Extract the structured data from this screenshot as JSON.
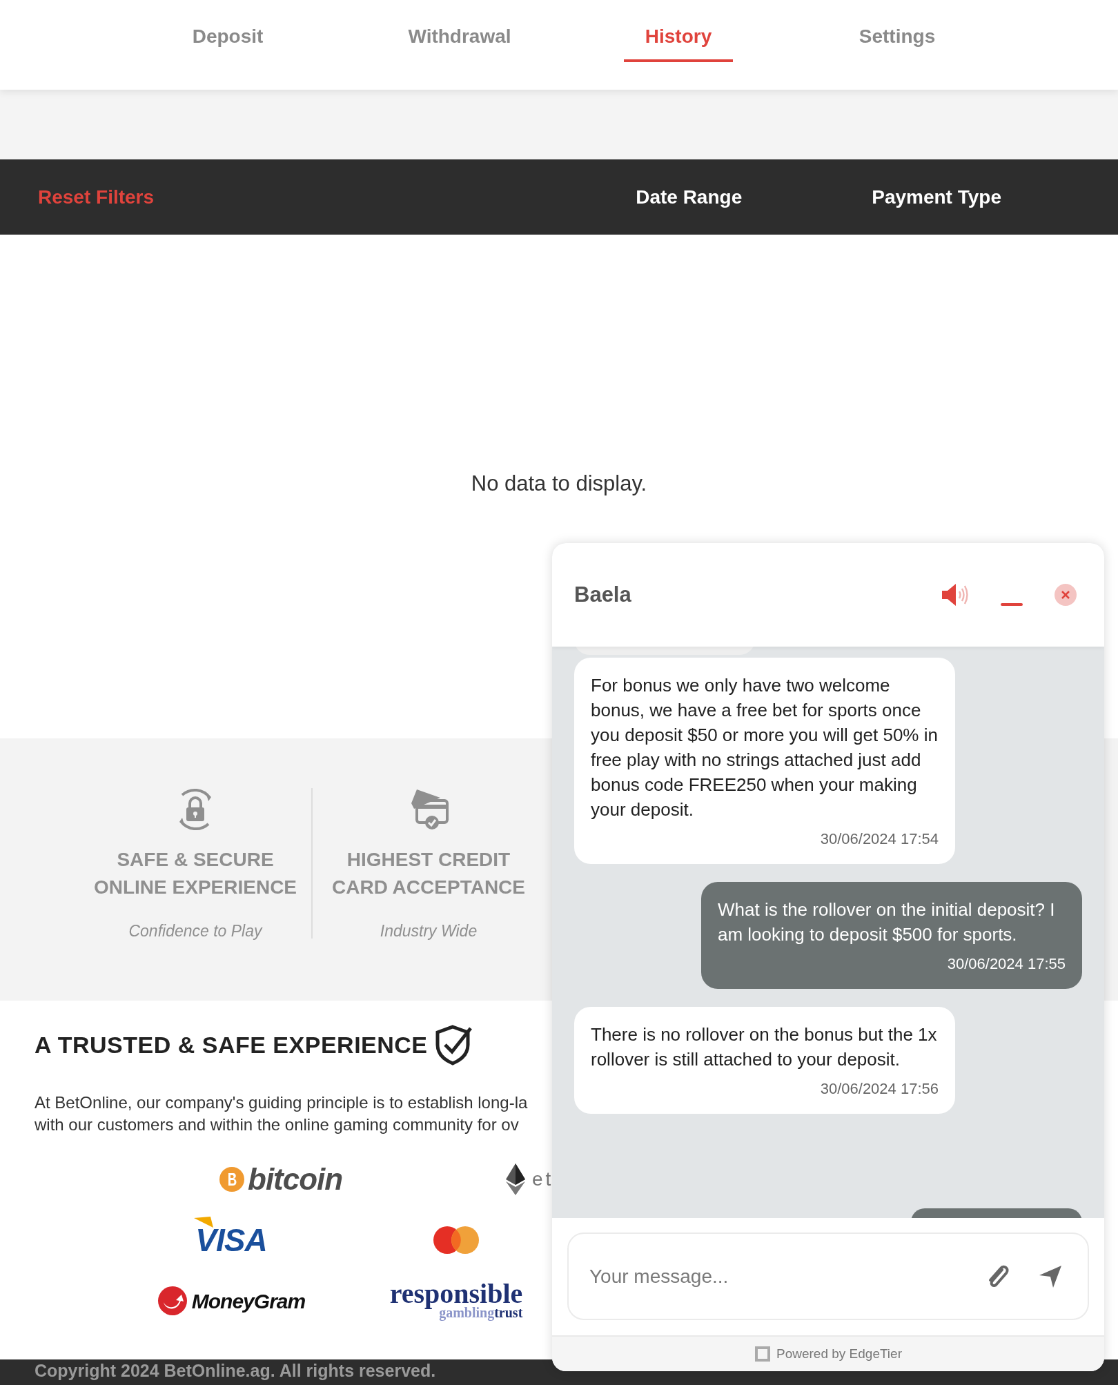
{
  "tabs": [
    {
      "label": "Deposit",
      "selected": false
    },
    {
      "label": "Withdrawal",
      "selected": false
    },
    {
      "label": "History",
      "selected": true
    },
    {
      "label": "Settings",
      "selected": false
    }
  ],
  "filter_bar": {
    "reset_label": "Reset Filters",
    "filters": [
      "Date Range",
      "Payment Type"
    ]
  },
  "empty_message": "No data to display.",
  "features": [
    {
      "kind": "lock",
      "title": "SAFE & SECURE ONLINE EXPERIENCE",
      "subtitle": "Confidence to Play"
    },
    {
      "kind": "card",
      "title": "HIGHEST CREDIT CARD ACCEPTANCE",
      "subtitle": "Industry Wide"
    }
  ],
  "trust": {
    "heading": "A TRUSTED & SAFE EXPERIENCE",
    "paragraph_lines": [
      "At BetOnline, our company's guiding principle is to establish long-la",
      "with our customers and within the online gaming community for ov"
    ],
    "logos": [
      {
        "kind": "bitcoin",
        "text": "bitcoin"
      },
      {
        "kind": "ethereum",
        "text": "et"
      },
      {
        "kind": "visa",
        "text": "VISA"
      },
      {
        "kind": "mastercard"
      },
      {
        "kind": "moneygram",
        "text": "MoneyGram"
      },
      {
        "kind": "responsible",
        "text": "responsible",
        "sub_a": "gambling",
        "sub_b": "trust"
      }
    ]
  },
  "copyright": "Copyright 2024 BetOnline.ag. All rights reserved.",
  "chat": {
    "agent_name": "Baela",
    "messages": [
      {
        "kind": "agent",
        "text": "For bonus we only have two welcome bonus, we have a free bet for sports once you deposit $50 or more you will get 50% in free play with no strings attached just add bonus code FREE250 when your making your deposit.",
        "time": "30/06/2024 17:54"
      },
      {
        "kind": "user",
        "text": "What is the rollover on the initial deposit? I am looking to deposit $500 for sports.",
        "time": "30/06/2024 17:55"
      },
      {
        "kind": "agent",
        "text": "There is no rollover on the bonus but the 1x rollover is still attached to your deposit.",
        "time": "30/06/2024 17:56"
      }
    ],
    "input": {
      "placeholder": "Your message..."
    },
    "powered_by": "Powered by EdgeTier"
  }
}
